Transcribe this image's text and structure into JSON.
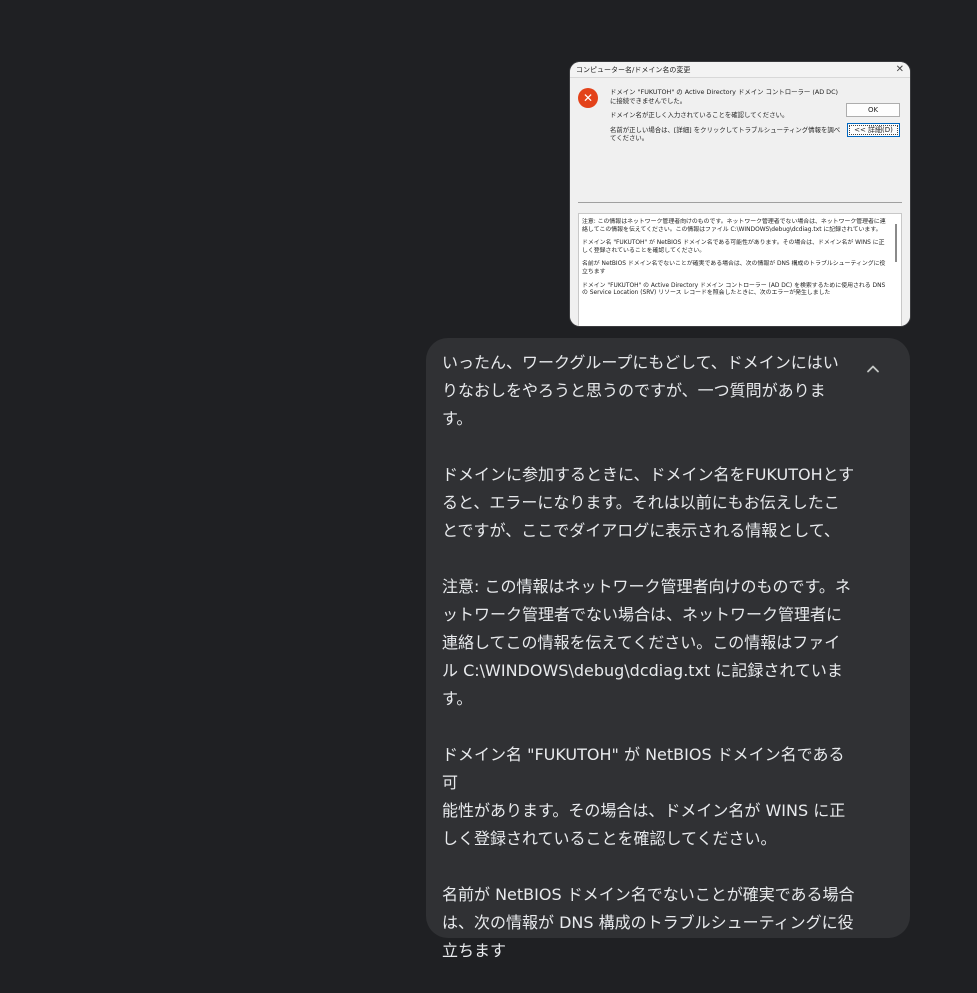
{
  "attachment": {
    "title": "コンピューター名/ドメイン名の変更",
    "close_glyph": "✕",
    "error_glyph": "✕",
    "message": [
      "ドメイン \"FUKUTOH\" の Active Directory ドメイン コントローラー (AD DC) に接続できませんでした。",
      "ドメイン名が正しく入力されていることを確認してください。",
      "名前が正しい場合は、[詳細] をクリックしてトラブルシューティング情報を調べてください。"
    ],
    "ok_label": "OK",
    "details_label": "<< 詳細(D)",
    "details": [
      "注意: この情報はネットワーク管理者向けのものです。ネットワーク管理者でない場合は、ネットワーク管理者に連絡してこの情報を伝えてください。この情報はファイル C:\\WINDOWS\\debug\\dcdiag.txt に記録されています。",
      "ドメイン名 \"FUKUTOH\" が NetBIOS ドメイン名である可能性があります。その場合は、ドメイン名が WINS に正しく登録されていることを確認してください。",
      "名前が NetBIOS ドメイン名でないことが確実である場合は、次の情報が DNS 構成のトラブルシューティングに役立ちます",
      "ドメイン \"FUKUTOH\" の Active Directory ドメイン コントローラー (AD DC) を検索するために使用される DNS の Service Location (SRV) リソース レコードを照会したときに、次のエラーが発生しました"
    ]
  },
  "message": {
    "paragraphs": [
      "いったん、ワークグループにもどして、ドメインにはい\nりなおしをやろうと思うのですが、一つ質問がありま\nす。",
      "ドメインに参加するときに、ドメイン名をFUKUTOHとす\nると、エラーになります。それは以前にもお伝えしたこ\nとですが、ここでダイアログに表示される情報として、",
      "注意: この情報はネットワーク管理者向けのものです。ネ\nットワーク管理者でない場合は、ネットワーク管理者に\n連絡してこの情報を伝えてください。この情報はファイ\nル C:\\WINDOWS\\debug\\dcdiag.txt に記録されています。",
      "ドメイン名 \"FUKUTOH\" が NetBIOS ドメイン名である可\n能性があります。その場合は、ドメイン名が WINS に正\nしく登録されていることを確認してください。",
      "名前が NetBIOS ドメイン名でないことが確実である場合\nは、次の情報が DNS 構成のトラブルシューティングに役\n立ちます"
    ],
    "collapse_icon": "chevron-up-icon"
  },
  "colors": {
    "page_bg": "#1f2023",
    "bubble_bg": "#303134",
    "text": "#e8eaed",
    "error_red": "#e3421a"
  }
}
